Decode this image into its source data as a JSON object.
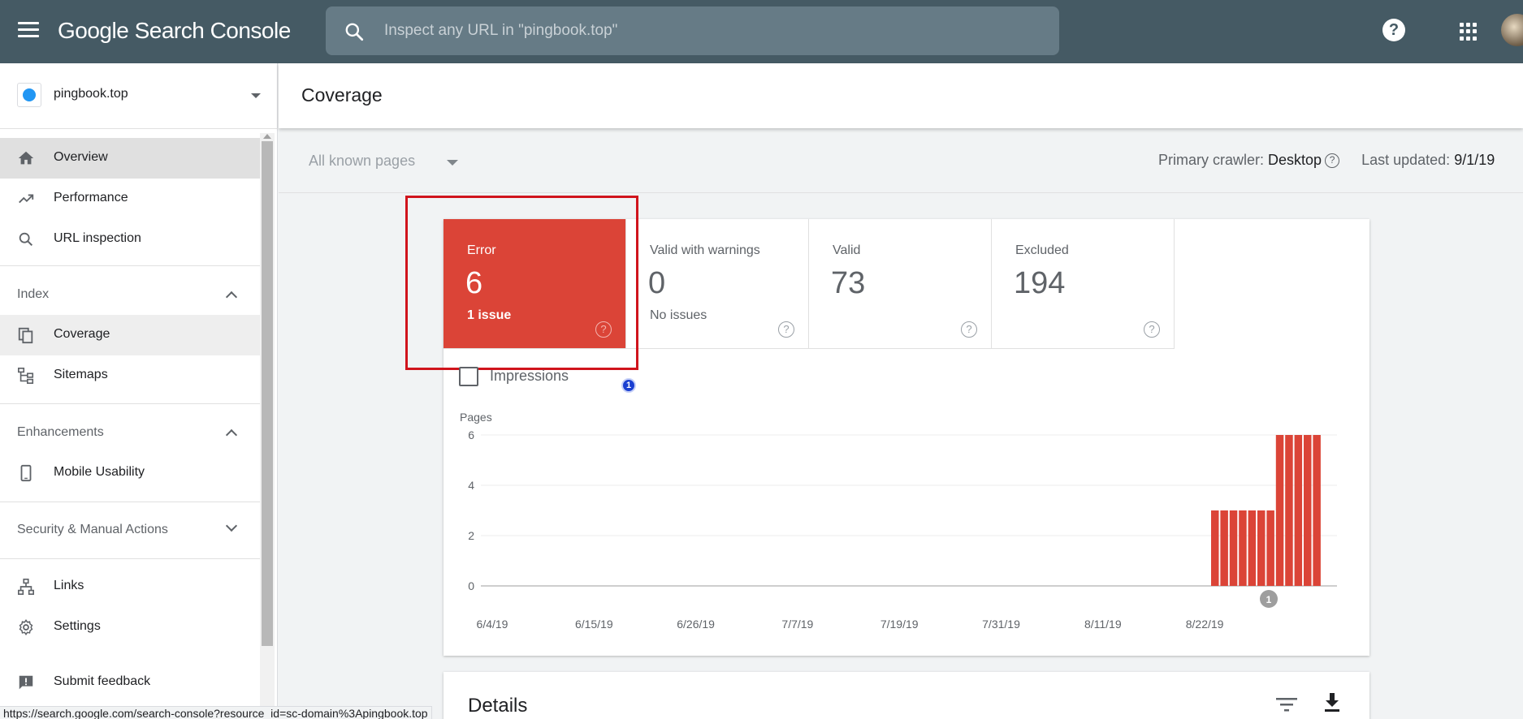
{
  "header": {
    "brand": "Google Search Console",
    "search_placeholder": "Inspect any URL in \"pingbook.top\""
  },
  "sidebar": {
    "property": "pingbook.top",
    "items": [
      {
        "label": "Overview",
        "icon": "home-icon"
      },
      {
        "label": "Performance",
        "icon": "trending-up-icon"
      },
      {
        "label": "URL inspection",
        "icon": "search-icon"
      }
    ],
    "sections": {
      "index": {
        "label": "Index",
        "items": [
          {
            "label": "Coverage",
            "icon": "pages-icon"
          },
          {
            "label": "Sitemaps",
            "icon": "sitemap-icon"
          }
        ]
      },
      "enhancements": {
        "label": "Enhancements",
        "items": [
          {
            "label": "Mobile Usability",
            "icon": "phone-icon"
          }
        ]
      },
      "security": {
        "label": "Security & Manual Actions"
      }
    },
    "bottom": [
      {
        "label": "Links",
        "icon": "links-icon"
      },
      {
        "label": "Settings",
        "icon": "gear-icon"
      },
      {
        "label": "Submit feedback",
        "icon": "feedback-icon"
      }
    ]
  },
  "page": {
    "title": "Coverage",
    "filter": "All known pages",
    "crawler_label": "Primary crawler:",
    "crawler_value": "Desktop",
    "updated_label": "Last updated:",
    "updated_value": "9/1/19"
  },
  "tiles": [
    {
      "label": "Error",
      "value": "6",
      "sub": "1 issue",
      "color": "#db4437"
    },
    {
      "label": "Valid with warnings",
      "value": "0",
      "sub": "No issues"
    },
    {
      "label": "Valid",
      "value": "73",
      "sub": ""
    },
    {
      "label": "Excluded",
      "value": "194",
      "sub": ""
    }
  ],
  "impressions_label": "Impressions",
  "annotation_badge": "1",
  "chart_data": {
    "type": "bar",
    "ylabel": "Pages",
    "ylim": [
      0,
      6
    ],
    "yticks": [
      0,
      2,
      4,
      6
    ],
    "xtick_labels": [
      "6/4/19",
      "6/15/19",
      "6/26/19",
      "7/7/19",
      "7/19/19",
      "7/31/19",
      "8/11/19",
      "8/22/19"
    ],
    "series": [
      {
        "color": "#db4437",
        "values": [
          3,
          3,
          3,
          3,
          3,
          3,
          3,
          6,
          6,
          6,
          6,
          6
        ]
      }
    ],
    "annotation": "1"
  },
  "details": {
    "title": "Details"
  },
  "statusbar": "https://search.google.com/search-console?resource_id=sc-domain%3Apingbook.top"
}
